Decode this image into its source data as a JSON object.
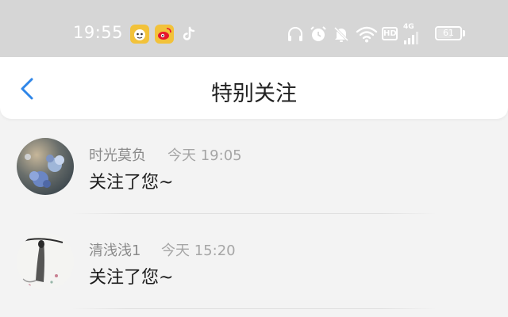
{
  "status_bar": {
    "time": "19:55",
    "app_icons": [
      "qq-pet-icon",
      "weibo-icon",
      "tiktok-icon"
    ],
    "system_icons": [
      "headphones-icon",
      "alarm-icon",
      "mute-icon",
      "wifi-icon",
      "hd-badge",
      "signal-icon",
      "battery-icon"
    ],
    "hd_label": "HD",
    "network_label": "4G",
    "battery_percent": "61",
    "battery_level": 0.61
  },
  "header": {
    "title": "特别关注",
    "back_icon": "chevron-left-icon"
  },
  "notifications": [
    {
      "name": "时光莫负",
      "time": "今天 19:05",
      "message": "关注了您~"
    },
    {
      "name": "清浅浅1",
      "time": "今天 15:20",
      "message": "关注了您~"
    }
  ],
  "colors": {
    "status_bar_bg": "#d6d6d6",
    "page_bg": "#f3f3f3",
    "header_bg": "#ffffff",
    "accent_blue": "#2f86e8",
    "name_gray": "#8a8a8a",
    "message_black": "#1c1c1c"
  }
}
